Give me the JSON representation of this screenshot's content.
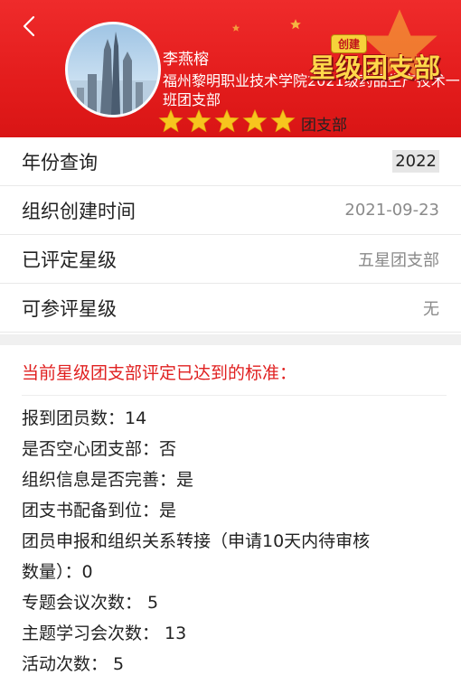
{
  "header": {
    "back_icon": "chevron-left-icon",
    "org_name": "李燕榕",
    "org_full_name": "福州黎明职业技术学院2021级药品生产技术一班团支部",
    "star_count": 5,
    "star_color": "#f7c51e",
    "org_type": "团支部",
    "badge_top": "创建",
    "badge_text": "星级团支部",
    "background_color": "#e31c1c"
  },
  "info_rows": [
    {
      "label": "年份查询",
      "value": "2022"
    },
    {
      "label": "组织创建时间",
      "value": "2021-09-23"
    },
    {
      "label": "已评定星级",
      "value": "五星团支部"
    },
    {
      "label": "可参评星级",
      "value": "无"
    }
  ],
  "standards": {
    "title": "当前星级团支部评定已达到的标准：",
    "items": [
      "报到团员数：14",
      "是否空心团支部：否",
      "组织信息是否完善：是",
      "团支书配备到位：是",
      "团员申报和组织关系转接（申请10天内待审核",
      "数量）：0",
      "专题会议次数： 5",
      "主题学习会次数： 13",
      "活动次数： 5"
    ]
  }
}
